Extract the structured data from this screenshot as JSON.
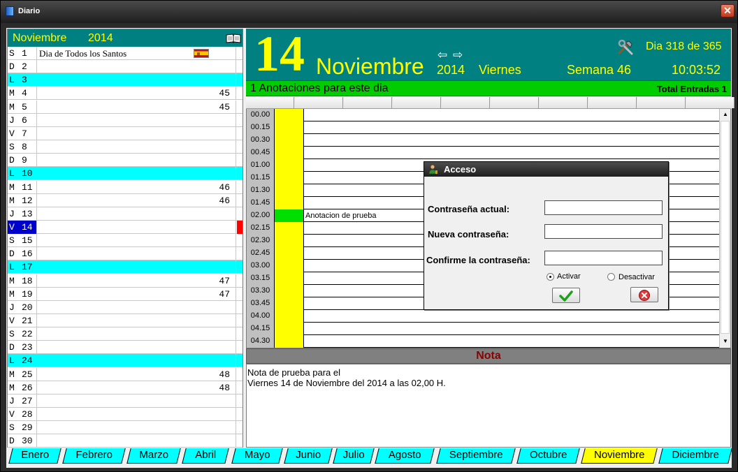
{
  "window": {
    "title": "Diario",
    "close_label": "✕",
    "app_icon": "diary-book-icon",
    "close_icon": "close-icon"
  },
  "calendar": {
    "month": "Noviembre",
    "year": "2014",
    "days": [
      {
        "letter": "S",
        "num": "1",
        "desc": "Dia de Todos los Santos",
        "week": "",
        "flag": true
      },
      {
        "letter": "D",
        "num": "2",
        "desc": "",
        "week": ""
      },
      {
        "letter": "L",
        "num": "3",
        "desc": "",
        "week": ""
      },
      {
        "letter": "M",
        "num": "4",
        "desc": "",
        "week": "45"
      },
      {
        "letter": "M",
        "num": "5",
        "desc": "",
        "week": "45"
      },
      {
        "letter": "J",
        "num": "6",
        "desc": "",
        "week": ""
      },
      {
        "letter": "V",
        "num": "7",
        "desc": "",
        "week": ""
      },
      {
        "letter": "S",
        "num": "8",
        "desc": "",
        "week": ""
      },
      {
        "letter": "D",
        "num": "9",
        "desc": "",
        "week": ""
      },
      {
        "letter": "L",
        "num": "10",
        "desc": "",
        "week": ""
      },
      {
        "letter": "M",
        "num": "11",
        "desc": "",
        "week": "46"
      },
      {
        "letter": "M",
        "num": "12",
        "desc": "",
        "week": "46"
      },
      {
        "letter": "J",
        "num": "13",
        "desc": "",
        "week": ""
      },
      {
        "letter": "V",
        "num": "14",
        "desc": "",
        "week": "",
        "selected": true
      },
      {
        "letter": "S",
        "num": "15",
        "desc": "",
        "week": ""
      },
      {
        "letter": "D",
        "num": "16",
        "desc": "",
        "week": ""
      },
      {
        "letter": "L",
        "num": "17",
        "desc": "",
        "week": ""
      },
      {
        "letter": "M",
        "num": "18",
        "desc": "",
        "week": "47"
      },
      {
        "letter": "M",
        "num": "19",
        "desc": "",
        "week": "47"
      },
      {
        "letter": "J",
        "num": "20",
        "desc": "",
        "week": ""
      },
      {
        "letter": "V",
        "num": "21",
        "desc": "",
        "week": ""
      },
      {
        "letter": "S",
        "num": "22",
        "desc": "",
        "week": ""
      },
      {
        "letter": "D",
        "num": "23",
        "desc": "",
        "week": ""
      },
      {
        "letter": "L",
        "num": "24",
        "desc": "",
        "week": ""
      },
      {
        "letter": "M",
        "num": "25",
        "desc": "",
        "week": "48"
      },
      {
        "letter": "M",
        "num": "26",
        "desc": "",
        "week": "48"
      },
      {
        "letter": "J",
        "num": "27",
        "desc": "",
        "week": ""
      },
      {
        "letter": "V",
        "num": "28",
        "desc": "",
        "week": ""
      },
      {
        "letter": "S",
        "num": "29",
        "desc": "",
        "week": ""
      },
      {
        "letter": "D",
        "num": "30",
        "desc": "",
        "week": ""
      }
    ]
  },
  "header": {
    "day": "14",
    "month": "Noviembre",
    "year": "2014",
    "weekday": "Viernes",
    "day_of_year": "Dia 318 de 365",
    "week": "Semana  46",
    "time": "10:03:52",
    "prev_arrow": "⇦",
    "next_arrow": "⇨",
    "tools_icon": "tools-icon"
  },
  "entries": {
    "count_text": "1 Anotaciones para este dia",
    "total_text": "Total Entradas 1"
  },
  "schedule": {
    "slots": [
      {
        "time": "00.00",
        "text": ""
      },
      {
        "time": "00.15",
        "text": ""
      },
      {
        "time": "00.30",
        "text": ""
      },
      {
        "time": "00.45",
        "text": ""
      },
      {
        "time": "01.00",
        "text": ""
      },
      {
        "time": "01.15",
        "text": ""
      },
      {
        "time": "01.30",
        "text": ""
      },
      {
        "time": "01.45",
        "text": ""
      },
      {
        "time": "02.00",
        "text": "Anotacion de prueba",
        "busy": true
      },
      {
        "time": "02.15",
        "text": ""
      },
      {
        "time": "02.30",
        "text": ""
      },
      {
        "time": "02.45",
        "text": ""
      },
      {
        "time": "03.00",
        "text": ""
      },
      {
        "time": "03.15",
        "text": ""
      },
      {
        "time": "03.30",
        "text": ""
      },
      {
        "time": "03.45",
        "text": ""
      },
      {
        "time": "04.00",
        "text": ""
      },
      {
        "time": "04.15",
        "text": ""
      },
      {
        "time": "04.30",
        "text": ""
      }
    ]
  },
  "note": {
    "title": "Nota",
    "line1": "Nota de prueba para el",
    "line2": "Viernes 14 de Noviembre del 2014 a las 02,00 H."
  },
  "tabs": [
    "Enero",
    "Febrero",
    "Marzo",
    "Abril",
    "Mayo",
    "Junio",
    "Julio",
    "Agosto",
    "Septiembre",
    "Octubre",
    "Noviembre",
    "Diciembre"
  ],
  "active_tab": "Noviembre",
  "dialog": {
    "title": "Acceso",
    "current_label": "Contraseña actual:",
    "new_label": "Nueva contraseña:",
    "confirm_label": "Confirme la contraseña:",
    "current_value": "",
    "new_value": "",
    "confirm_value": "",
    "activate_label": "Activar",
    "deactivate_label": "Desactivar",
    "selected_option": "Activar",
    "ok_icon": "checkmark-icon",
    "cancel_icon": "cancel-icon",
    "user_icon": "user-key-icon"
  },
  "colors": {
    "teal": "#008080",
    "yellow": "#ffff00",
    "cyan": "#00ffff",
    "green": "#00cc00",
    "selected": "#0000cc",
    "note_title": "#8b0000"
  }
}
